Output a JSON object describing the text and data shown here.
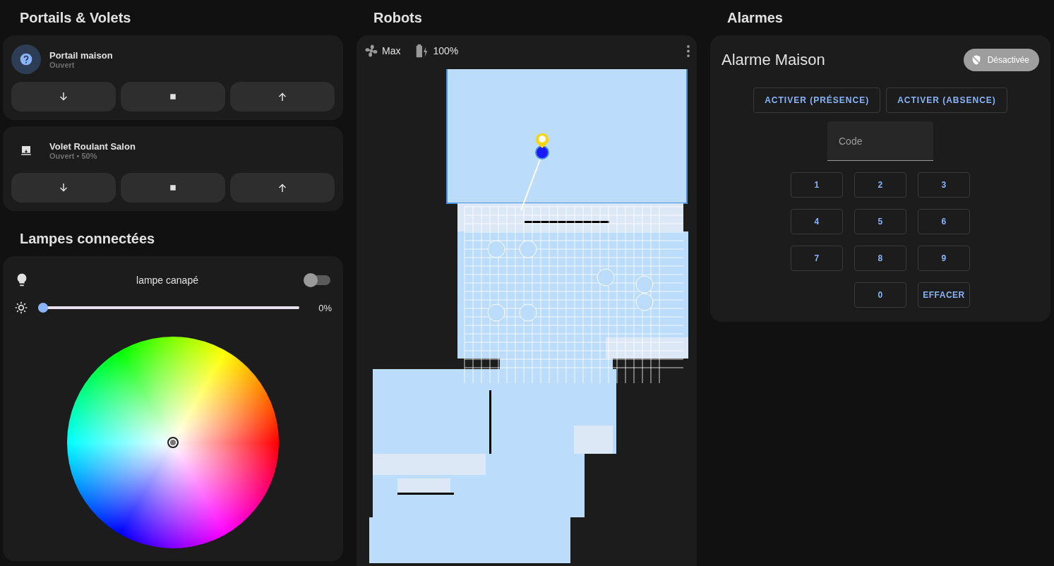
{
  "covers": {
    "title": "Portails & Volets",
    "items": [
      {
        "kind": "gate",
        "name": "Portail maison",
        "state": "Ouvert"
      },
      {
        "kind": "shutter",
        "name": "Volet Roulant Salon",
        "state": "Ouvert • 50%"
      }
    ]
  },
  "lights": {
    "title": "Lampes connectées",
    "lamp": {
      "name": "lampe canapé",
      "on": false,
      "brightness": {
        "level": 0,
        "reading": "0%"
      }
    }
  },
  "robots": {
    "title": "Robots",
    "fan_speed": "Max",
    "battery": "100%"
  },
  "alarms": {
    "title": "Alarmes",
    "card": {
      "name": "Alarme Maison",
      "state": "Désactivée",
      "armed": false,
      "actions": [
        "ACTIVER (PRÉSENCE)",
        "ACTIVER (ABSENCE)"
      ],
      "code": {
        "placeholder": "Code"
      },
      "keys": [
        "1",
        "2",
        "3",
        "4",
        "5",
        "6",
        "7",
        "8",
        "9",
        "0",
        "EFFACER"
      ]
    }
  }
}
